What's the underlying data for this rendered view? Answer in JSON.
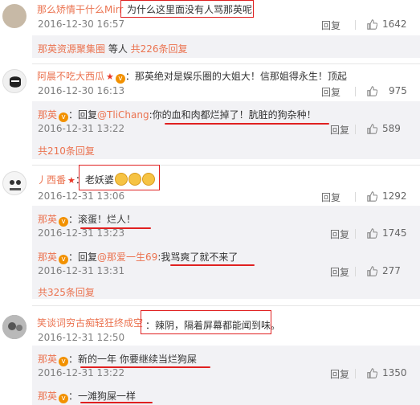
{
  "comments": [
    {
      "user": "那么矫情干什么Mirr",
      "text": "为什么这里面没有人骂那英呢",
      "time": "2016-12-30 16:57",
      "reply_label": "回复",
      "likes": "1642",
      "more_replies": {
        "name": "那英资源聚集圈",
        "mid": " 等人 ",
        "count": "共226条回复"
      }
    },
    {
      "user": "阿晨不吃大西瓜",
      "text": "：那英绝对是娱乐圈的大姐大！信那姐得永生！顶起",
      "time": "2016-12-30 16:13",
      "reply_label": "回复",
      "likes": "975",
      "reply": {
        "user": "那英",
        "prefix": "：回复",
        "mention": "@TliChang",
        "text": ":你的血和肉都烂掉了！肮脏的狗杂种！",
        "time": "2016-12-31 13:22",
        "reply_label": "回复",
        "likes": "589"
      },
      "more_replies": "共210条回复"
    },
    {
      "user": "丿西番",
      "text": "：老妖婆",
      "time": "2016-12-31 13:06",
      "reply_label": "回复",
      "likes": "1292",
      "replies": [
        {
          "user": "那英",
          "text": "：滚蛋！烂人！",
          "time": "2016-12-31 13:23",
          "reply_label": "回复",
          "likes": "1745"
        },
        {
          "user": "那英",
          "prefix": "：回复",
          "mention": "@那爱一生69",
          "text": ":我骂爽了就不来了",
          "time": "2016-12-31 13:31",
          "reply_label": "回复",
          "likes": "277"
        }
      ],
      "more_replies": "共325条回复"
    },
    {
      "user": "笑谈词穷古痴轻狂终成空",
      "text": "：辣阴，隔着屏幕都能闻到味。",
      "time": "2016-12-31 12:50",
      "replies": [
        {
          "user": "那英",
          "text": "：新的一年 你要继续当烂狗屎",
          "time": "2016-12-31 13:22",
          "reply_label": "回复",
          "likes": "1350"
        },
        {
          "user": "那英",
          "text": "：一滩狗屎一样"
        }
      ]
    }
  ],
  "icons": {
    "thumb": "thumbs-up-icon",
    "vip": "vip-badge-icon",
    "star": "star-badge-icon",
    "emoji": "laughing-emoji-icon"
  },
  "colors": {
    "username": "#eb7350",
    "highlight": "#e02020",
    "reply_bg": "#f2f2f5"
  }
}
